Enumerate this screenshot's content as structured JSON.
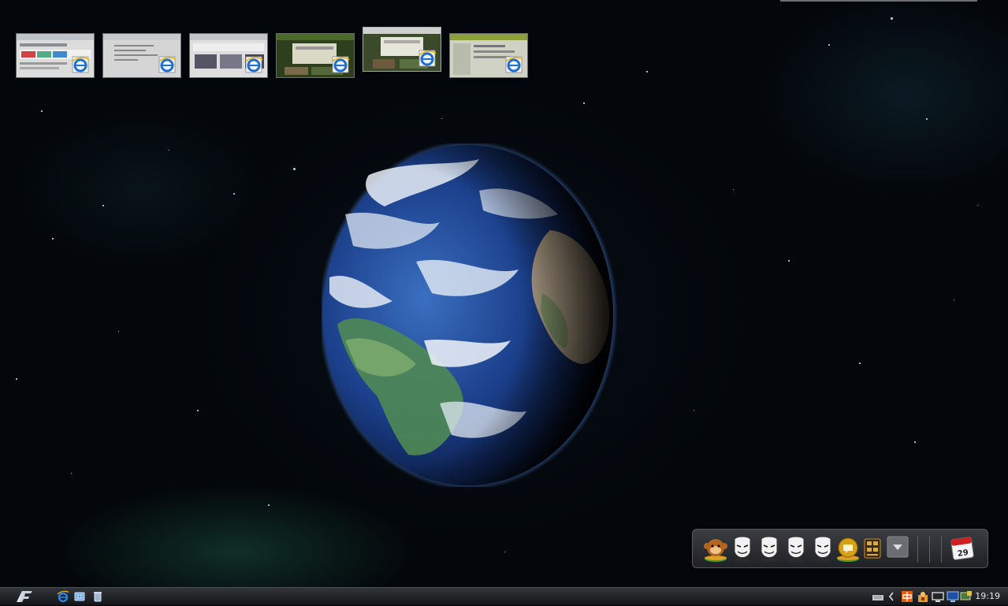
{
  "window_thumbnails": [
    {
      "name": "ie-window-1",
      "theme": "#e6e6e6",
      "icon": "internet-explorer-icon",
      "active": false
    },
    {
      "name": "ie-window-2",
      "theme": "#d8d8d8",
      "icon": "internet-explorer-icon",
      "active": false
    },
    {
      "name": "ie-window-3",
      "theme": "#e0e0e0",
      "icon": "internet-explorer-icon",
      "active": false
    },
    {
      "name": "ie-window-4",
      "theme": "#2e3f1e",
      "icon": "internet-explorer-icon",
      "active": false
    },
    {
      "name": "ie-window-5",
      "theme": "#3a4a2a",
      "icon": "internet-explorer-icon",
      "active": true
    },
    {
      "name": "ie-window-6",
      "theme": "#6a7a3a",
      "icon": "internet-explorer-icon",
      "active": false
    }
  ],
  "dock": {
    "items": [
      "monkey-icon",
      "mask-icon",
      "mask-icon",
      "mask-icon",
      "mask-icon",
      "chat-icon",
      "grid-icon",
      "dropdown-arrow-icon",
      "calendar-icon"
    ],
    "calendar_day": "29"
  },
  "taskbar": {
    "start_icon": "start-logo-icon",
    "quick_launch": [
      "internet-explorer-icon",
      "explorer-icon",
      "recycle-icon"
    ],
    "tray": [
      "keyboard-icon",
      "chevron-left-icon",
      "input-method-icon",
      "tray-app-icon",
      "monitor-icon",
      "network-icon",
      "display-icon"
    ],
    "clock": "19:19"
  },
  "colors": {
    "taskbar": "#1f2124",
    "ie_blue": "#1e6fd0",
    "calendar_red": "#d11f1f",
    "earth_ocean": "#1b3f8a"
  }
}
